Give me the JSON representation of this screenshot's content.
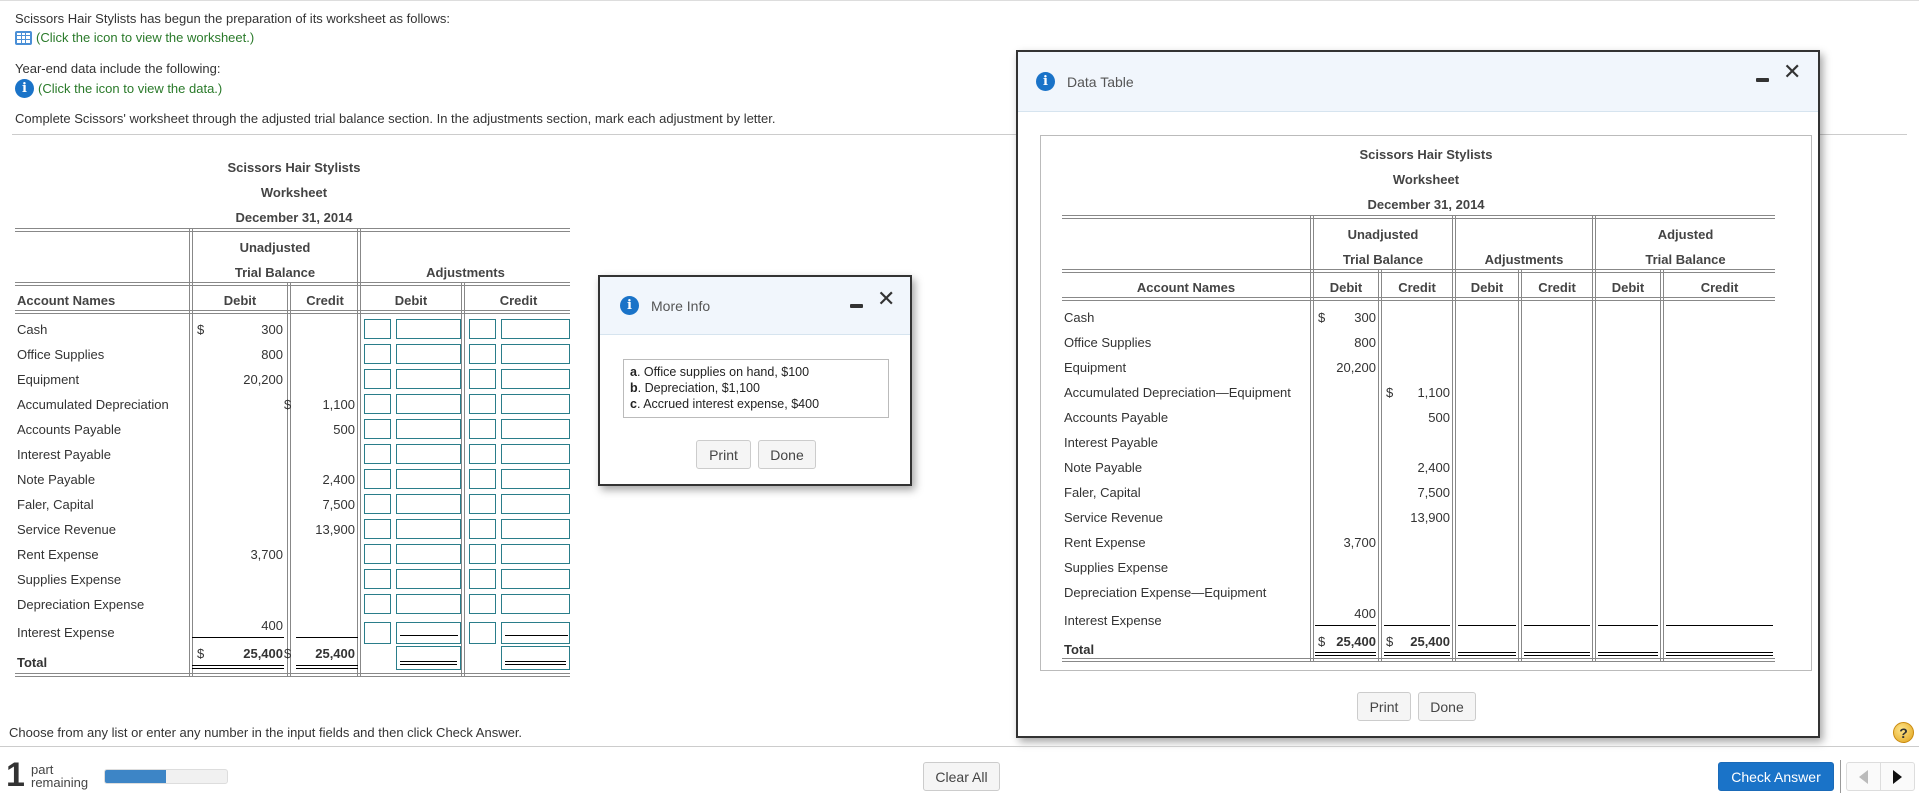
{
  "intro": {
    "line1": "Scissors Hair Stylists has begun the preparation of its worksheet as follows:",
    "link1": "(Click the icon to view the worksheet.)",
    "line2": "Year-end data include the following:",
    "link2": "(Click the icon to view the data.)",
    "instruction": "Complete Scissors' worksheet through the adjusted trial balance section. In the adjustments section, mark each adjustment by letter."
  },
  "worksheet": {
    "company": "Scissors Hair Stylists",
    "title": "Worksheet",
    "date": "December 31, 2014",
    "group_unadjusted_1": "Unadjusted",
    "group_unadjusted_2": "Trial Balance",
    "group_adjustments": "Adjustments",
    "col_account": "Account Names",
    "col_debit": "Debit",
    "col_credit": "Credit",
    "currency": "$",
    "rows": [
      {
        "name": "Cash",
        "debit": "300",
        "credit": "",
        "debit_dollar": true
      },
      {
        "name": "Office Supplies",
        "debit": "800",
        "credit": ""
      },
      {
        "name": "Equipment",
        "debit": "20,200",
        "credit": ""
      },
      {
        "name": "Accumulated Depreciation",
        "debit": "",
        "credit": "1,100",
        "credit_dollar": true
      },
      {
        "name": "Accounts Payable",
        "debit": "",
        "credit": "500"
      },
      {
        "name": "Interest Payable",
        "debit": "",
        "credit": ""
      },
      {
        "name": "Note Payable",
        "debit": "",
        "credit": "2,400"
      },
      {
        "name": "Faler, Capital",
        "debit": "",
        "credit": "7,500"
      },
      {
        "name": "Service Revenue",
        "debit": "",
        "credit": "13,900"
      },
      {
        "name": "Rent Expense",
        "debit": "3,700",
        "credit": ""
      },
      {
        "name": "Supplies Expense",
        "debit": "",
        "credit": ""
      },
      {
        "name": "Depreciation Expense",
        "debit": "",
        "credit": ""
      },
      {
        "name": "Interest Expense",
        "debit": "400",
        "credit": ""
      }
    ],
    "total_label": "Total",
    "total_debit": "25,400",
    "total_credit": "25,400"
  },
  "more_info": {
    "title": "More Info",
    "items": [
      {
        "letter": "a",
        "text": ". Office supplies on hand, $100"
      },
      {
        "letter": "b",
        "text": ". Depreciation, $1,100"
      },
      {
        "letter": "c",
        "text": ". Accrued interest expense, $400"
      }
    ],
    "print_label": "Print",
    "done_label": "Done"
  },
  "data_table": {
    "title": "Data Table",
    "company": "Scissors Hair Stylists",
    "worksheet": "Worksheet",
    "date": "December 31, 2014",
    "group_unadjusted_1": "Unadjusted",
    "group_unadjusted_2": "Trial Balance",
    "group_adjustments": "Adjustments",
    "group_adjusted_1": "Adjusted",
    "group_adjusted_2": "Trial Balance",
    "col_account": "Account Names",
    "col_debit": "Debit",
    "col_credit": "Credit",
    "currency": "$",
    "rows": [
      {
        "name": "Cash",
        "debit": "300",
        "credit": "",
        "debit_dollar": true
      },
      {
        "name": "Office Supplies",
        "debit": "800",
        "credit": ""
      },
      {
        "name": "Equipment",
        "debit": "20,200",
        "credit": ""
      },
      {
        "name": "Accumulated Depreciation—Equipment",
        "debit": "",
        "credit": "1,100",
        "credit_dollar": true
      },
      {
        "name": "Accounts Payable",
        "debit": "",
        "credit": "500"
      },
      {
        "name": "Interest Payable",
        "debit": "",
        "credit": ""
      },
      {
        "name": "Note Payable",
        "debit": "",
        "credit": "2,400"
      },
      {
        "name": "Faler, Capital",
        "debit": "",
        "credit": "7,500"
      },
      {
        "name": "Service Revenue",
        "debit": "",
        "credit": "13,900"
      },
      {
        "name": "Rent Expense",
        "debit": "3,700",
        "credit": ""
      },
      {
        "name": "Supplies Expense",
        "debit": "",
        "credit": ""
      },
      {
        "name": "Depreciation Expense—Equipment",
        "debit": "",
        "credit": ""
      },
      {
        "name": "Interest Expense",
        "debit": "400",
        "credit": ""
      }
    ],
    "total_label": "Total",
    "total_debit": "25,400",
    "total_credit": "25,400",
    "print_label": "Print",
    "done_label": "Done"
  },
  "footer": {
    "hint": "Choose from any list or enter any number in the input fields and then click Check Answer.",
    "parts_count": "1",
    "parts_label_1": "part",
    "parts_label_2": "remaining",
    "progress_fraction": 0.5,
    "clear_all": "Clear All",
    "check_answer": "Check Answer",
    "help": "?"
  },
  "colors": {
    "accent": "#1a73c8",
    "link": "#2a7a2a",
    "input_border": "#2a7d8a",
    "progress": "#3d85c6"
  }
}
